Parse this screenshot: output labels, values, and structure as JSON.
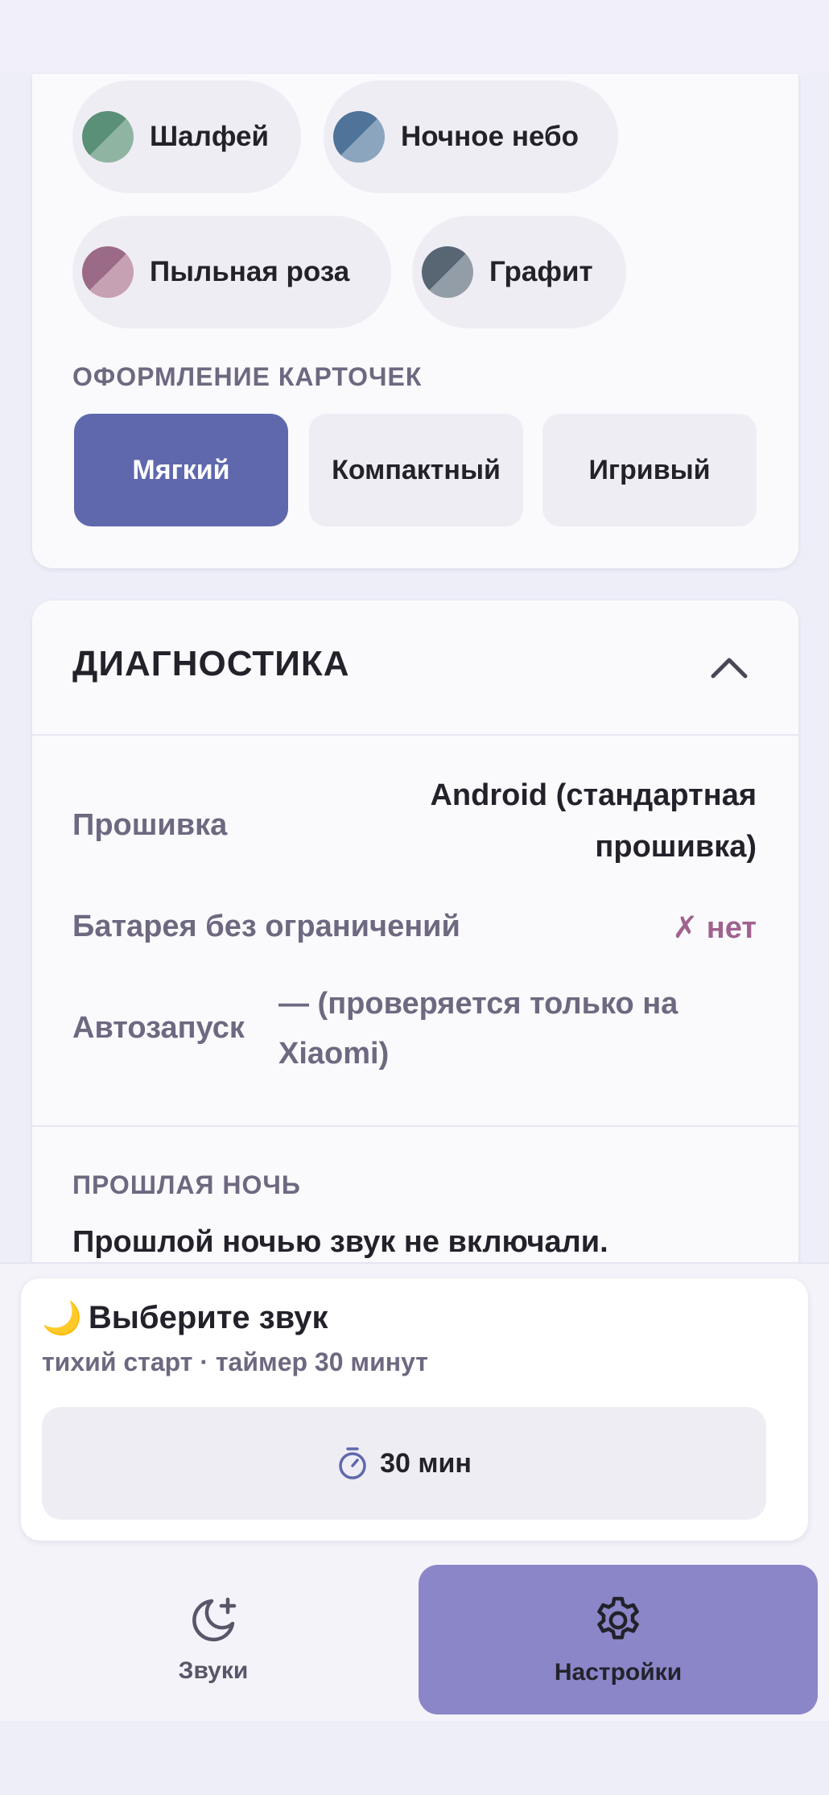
{
  "appearance": {
    "themes": [
      {
        "label": "Шалфей",
        "color_a": "#5a8f78",
        "color_b": "#8fb5a2"
      },
      {
        "label": "Ночное небо",
        "color_a": "#4f7399",
        "color_b": "#8ba5bf"
      },
      {
        "label": "Пыльная роза",
        "color_a": "#9b6a86",
        "color_b": "#c6a0b3"
      },
      {
        "label": "Графит",
        "color_a": "#586674",
        "color_b": "#939da8"
      }
    ],
    "card_style_caption": "ОФОРМЛЕНИЕ КАРТОЧЕК",
    "card_styles": [
      "Мягкий",
      "Компактный",
      "Игривый"
    ],
    "card_style_selected": "Мягкий"
  },
  "diagnostics": {
    "title": "ДИАГНОСТИКА",
    "firmware_label": "Прошивка",
    "firmware_value_line1": "Android (стандартная",
    "firmware_value_line2": "прошивка)",
    "battery_label": "Батарея без ограничений",
    "battery_value": "✗ нет",
    "autostart_label": "Автозапуск",
    "autostart_value": "— (проверяется только на Xiaomi)",
    "last_night_caption": "ПРОШЛАЯ НОЧЬ",
    "last_night_text": "Прошлой ночью звук не включали."
  },
  "player": {
    "emoji": "🌙",
    "title": "Выберите звук",
    "subtitle": "тихий старт · таймер 30 минут",
    "timer_label": "30 мин"
  },
  "nav": {
    "sounds_label": "Звуки",
    "settings_label": "Настройки",
    "active": "Настройки"
  },
  "colors": {
    "accent": "#5f68ad",
    "nav_active": "#8a86c8",
    "negative": "#a0628f"
  }
}
